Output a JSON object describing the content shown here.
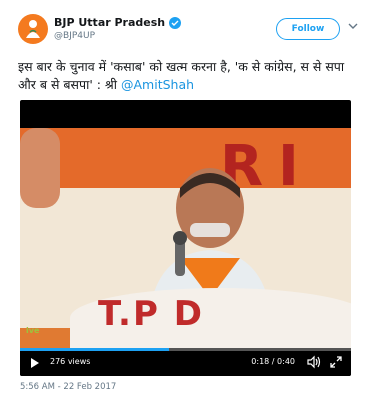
{
  "account": {
    "name": "BJP Uttar Pradesh",
    "handle": "@BJP4UP",
    "verified": true,
    "avatar_color": "#f47a1f"
  },
  "follow_label": "Follow",
  "tweet": {
    "text": "इस बार के चुनाव में 'कसाब' को खत्म करना है, 'क से कांग्रेस, स से सपा और ब से बसपा' : श्री ",
    "mention": "@AmitShah"
  },
  "video": {
    "podium_text": "T.P D",
    "backdrop_letters": [
      "R",
      "I"
    ],
    "views": "276 views",
    "time": "0:18 / 0:40",
    "progress": 0.45,
    "watermark": "ive"
  },
  "timestamp": "5:56 AM - 22 Feb 2017",
  "colors": {
    "accent": "#1da1f2",
    "mention": "#1b95e0"
  },
  "icons": [
    "verified-icon",
    "chevron-down-icon",
    "play-icon",
    "volume-icon",
    "fullscreen-icon"
  ]
}
